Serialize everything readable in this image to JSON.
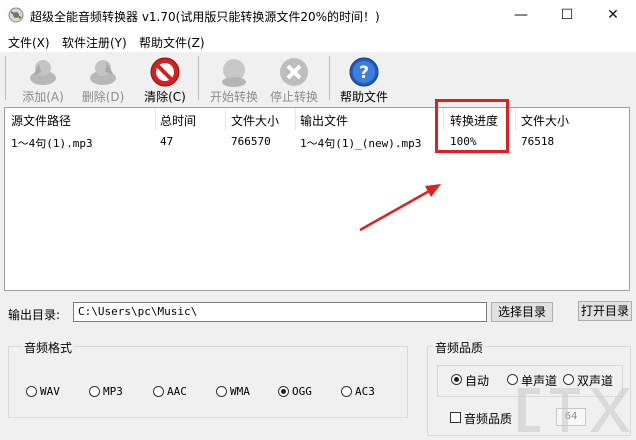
{
  "window": {
    "title": "超级全能音频转换器 v1.70(试用版只能转换源文件20%的时间！)",
    "minimize_symbol": "—",
    "maximize_symbol": "☐",
    "close_symbol": "✕"
  },
  "menu": [
    "文件(X)",
    "软件注册(Y)",
    "帮助文件(Z)"
  ],
  "toolbar": {
    "add": "添加(A)",
    "delete": "删除(D)",
    "clear": "清除(C)",
    "start": "开始转换",
    "stop": "停止转换",
    "help": "帮助文件"
  },
  "table": {
    "headers": [
      "源文件路径",
      "总时间",
      "文件大小",
      "输出文件",
      "转换进度",
      "文件大小"
    ],
    "rows": [
      [
        "1～4句(1).mp3",
        "47",
        "766570",
        "1～4句(1)_(new).mp3",
        "100%",
        "76518"
      ]
    ]
  },
  "output": {
    "label": "输出目录:",
    "path": "C:\\Users\\pc\\Music\\",
    "choose_button": "选择目录",
    "open_button": "打开目录"
  },
  "format": {
    "title": "音频格式",
    "options": [
      "WAV",
      "MP3",
      "AAC",
      "WMA",
      "OGG",
      "AC3"
    ],
    "selected": "OGG"
  },
  "quality": {
    "title": "音频品质",
    "channels": [
      "自动",
      "单声道",
      "双声道"
    ],
    "selected": "自动",
    "checkbox_label": "音频品质",
    "checked": false,
    "bitrate": "64"
  },
  "colors": {
    "annotation": "#e21f1f",
    "help_icon": "#1f5fbf",
    "clear_icon": "#d42020"
  },
  "icons": {
    "app": "app-icon",
    "add": "add-file-icon",
    "delete": "delete-file-icon",
    "clear": "clear-icon",
    "start": "start-convert-icon",
    "stop": "stop-convert-icon",
    "help": "help-icon"
  }
}
